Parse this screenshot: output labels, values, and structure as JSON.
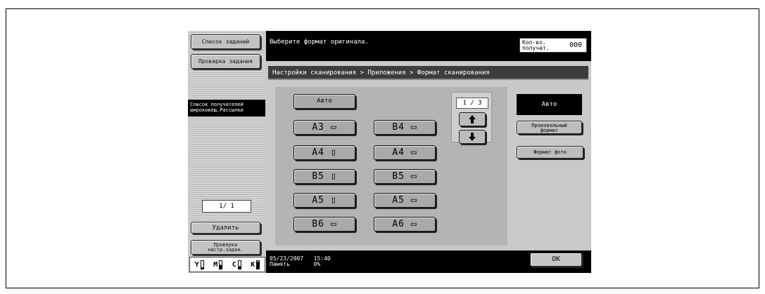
{
  "left_panel": {
    "job_list": "Список заданий",
    "job_check": "Проверка задания",
    "dest_list_1": "Список получателей",
    "dest_list_2": "широковещ.Рассылки",
    "page_indicator": "1/  1",
    "delete": "Удалить",
    "check_settings_1": "Проверка",
    "check_settings_2": "настр.задан.",
    "toner": [
      {
        "label": "Y",
        "level": 0.2
      },
      {
        "label": "M",
        "level": 0.5
      },
      {
        "label": "C",
        "level": 0.3
      },
      {
        "label": "K",
        "level": 0.9
      }
    ]
  },
  "header": {
    "message": "Выберите формат оригинала.",
    "copies_label_1": "Кол-во.",
    "copies_label_2": "получат.",
    "copies_value": "000"
  },
  "breadcrumb": "Настройки сканирования > Приложения > Формат сканирования",
  "formats": {
    "auto": "Авто",
    "left": [
      "A3 ▭",
      "A4 ▯",
      "B5 ▯",
      "A5 ▯",
      "B6 ▭"
    ],
    "right": [
      "B4 ▭",
      "A4 ▭",
      "B5 ▭",
      "A5 ▭",
      "A6 ▭"
    ]
  },
  "pager": {
    "value": "1 / 3",
    "up_icon": "arrow-up-icon",
    "down_icon": "arrow-down-icon"
  },
  "right_options": {
    "auto": "Авто",
    "custom_1": "Произвольный",
    "custom_2": "формат",
    "photo": "Формат фото"
  },
  "footer": {
    "date": "05/23/2007",
    "time": "15:40",
    "memory_label": "Память",
    "memory_value": "0%",
    "ok": "OK"
  }
}
